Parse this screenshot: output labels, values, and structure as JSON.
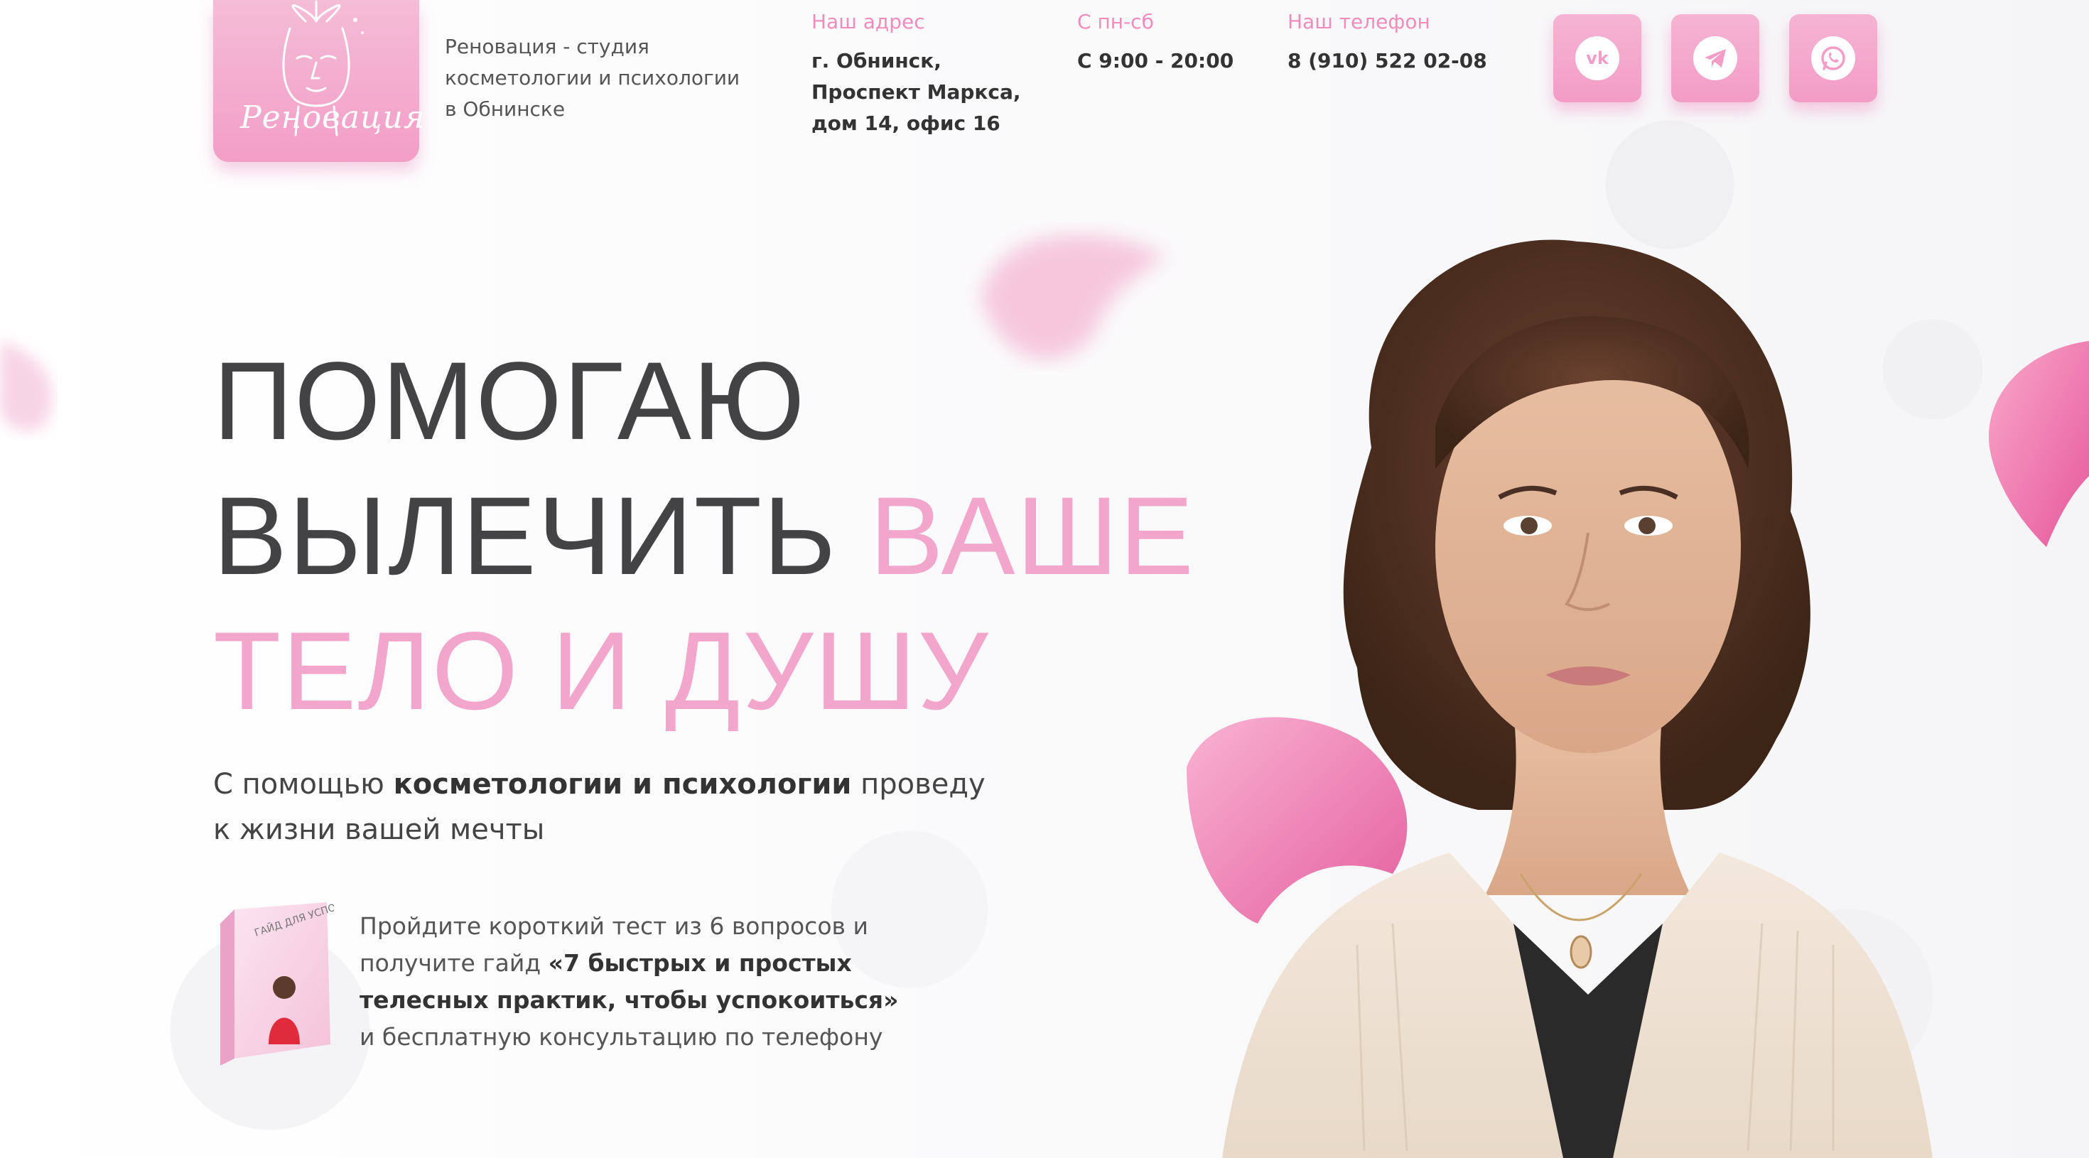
{
  "header": {
    "logo_text": "Реновация",
    "studio_description": "Реновация - студия косметологии и психологии в Обнинске",
    "address": {
      "label": "Наш адрес",
      "value": "г. Обнинск, Проспект Маркса, дом 14, офис 16"
    },
    "hours": {
      "label": "С пн-сб",
      "value": "С 9:00 - 20:00"
    },
    "phone": {
      "label": "Наш телефон",
      "value": "8 (910) 522 02-08"
    },
    "social": [
      {
        "name": "vk",
        "icon": "vk-icon",
        "glyph": "vk"
      },
      {
        "name": "telegram",
        "icon": "telegram-icon"
      },
      {
        "name": "whatsapp",
        "icon": "whatsapp-icon"
      }
    ]
  },
  "hero": {
    "headline_line1": "ПОМОГАЮ",
    "headline_line2_dark": "ВЫЛЕЧИТЬ ",
    "headline_line2_pink": "ВАШЕ",
    "headline_line3": "ТЕЛО И ДУШУ",
    "subtitle_part1": "С помощью ",
    "subtitle_bold1": "косметологии",
    "subtitle_part2": " и ",
    "subtitle_bold2": "психологии",
    "subtitle_part3": " проведу",
    "subtitle_line2": "к жизни вашей мечты",
    "guide_part1": "Пройдите короткий тест из 6 вопросов и получите гайд ",
    "guide_bold": "«7 быстрых и простых телесных практик, чтобы успокоиться»",
    "guide_part2": " и бесплатную консультацию по телефону",
    "guide_cover_text": "ГАЙД ДЛЯ УСПОКОЕНИЯ"
  },
  "colors": {
    "accent_pink": "#f3a6cb",
    "label_pink": "#f08cbc",
    "text_dark": "#434345"
  }
}
